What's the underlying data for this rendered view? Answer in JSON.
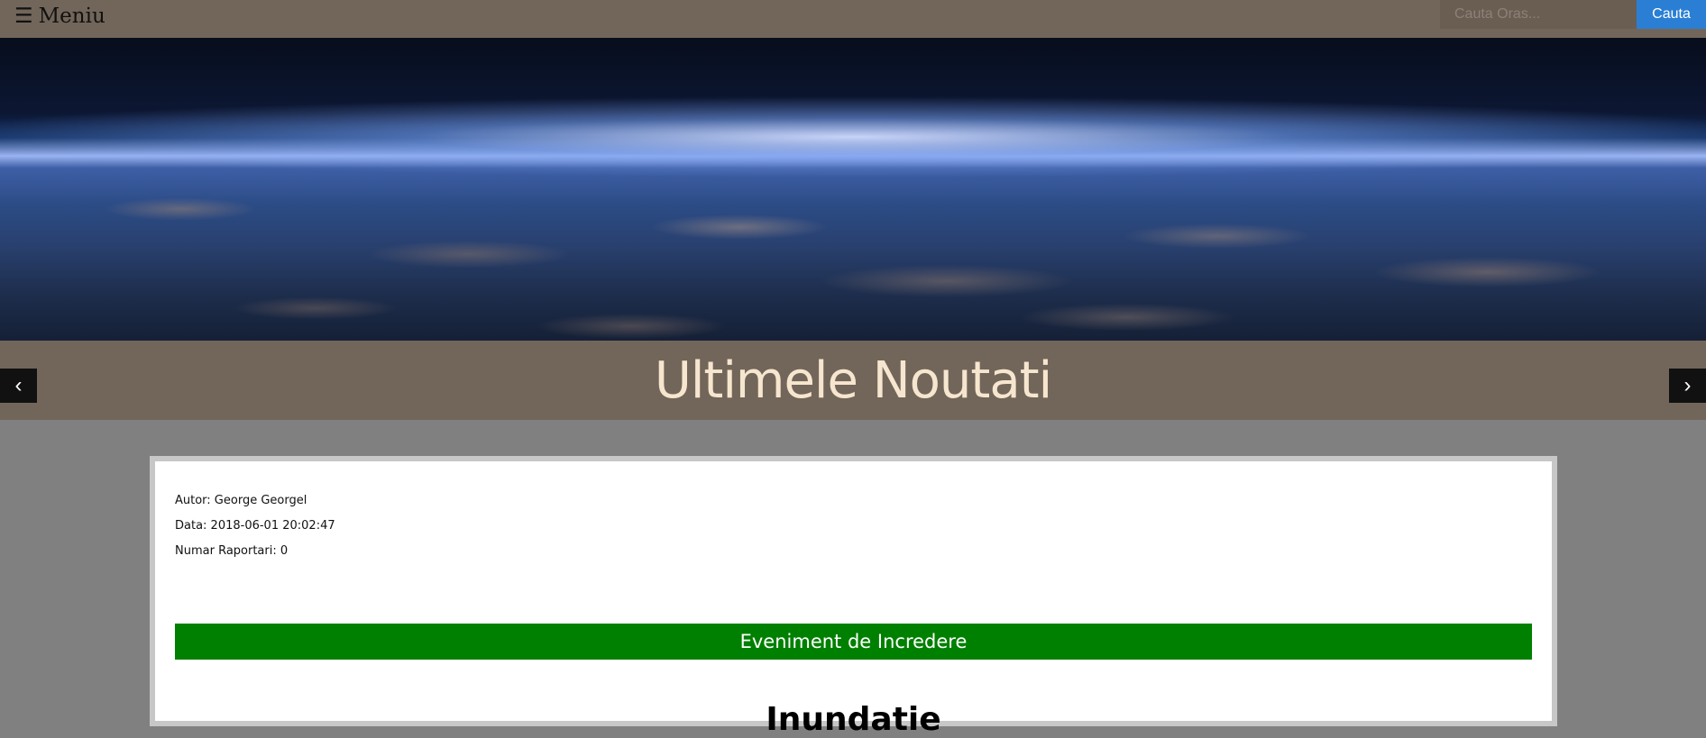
{
  "header": {
    "menu_icon": "hamburger-icon",
    "menu_glyph": "☰",
    "menu_label": "Meniu",
    "search_placeholder": "Cauta Oras...",
    "search_button": "Cauta"
  },
  "carousel": {
    "title": "Ultimele Noutati",
    "prev_glyph": "‹",
    "next_glyph": "›"
  },
  "article": {
    "author": "Autor: George Georgel",
    "date": "Data: 2018-06-01 20:02:47",
    "reports": "Numar Raportari: 0",
    "trust_badge": "Eveniment de Incredere",
    "event_title": "Inundatie"
  },
  "colors": {
    "header_bg": "#72665a",
    "page_bg": "#808080",
    "search_button": "#2a7fd4",
    "trust_badge": "#008000",
    "title_text": "#f7e6cf"
  }
}
